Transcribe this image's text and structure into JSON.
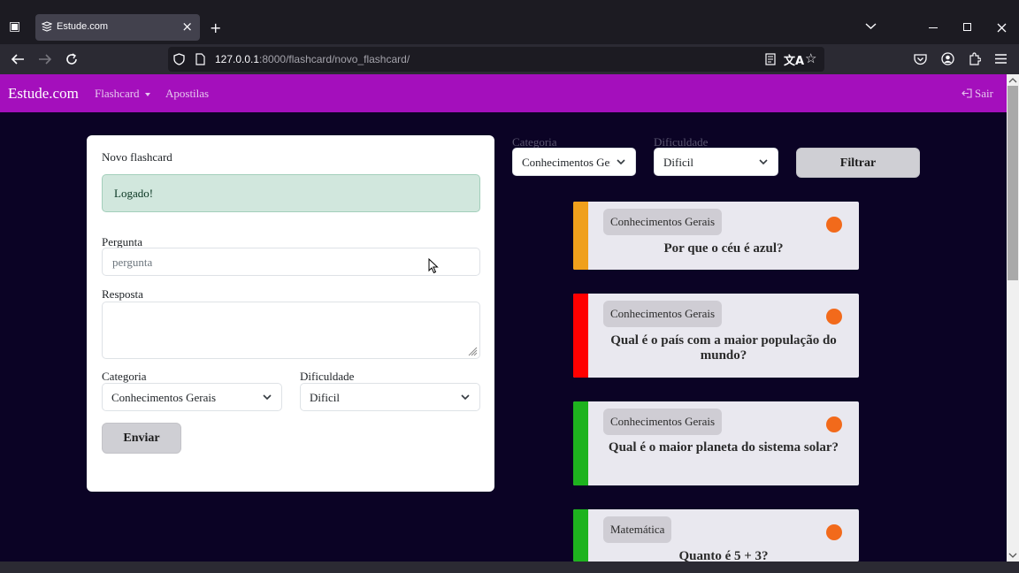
{
  "browser": {
    "tab_title": "Estude.com",
    "tab_close": "×",
    "new_tab": "+",
    "url_host": "127.0.0.1",
    "url_rest": ":8000/flashcard/novo_flashcard/"
  },
  "site_nav": {
    "brand": "Estude.com",
    "flashcard": "Flashcard",
    "apostilas": "Apostilas",
    "sair": "Sair"
  },
  "form": {
    "title": "Novo flashcard",
    "alert": "Logado!",
    "pergunta_label": "Pergunta",
    "pergunta_placeholder": "pergunta",
    "resposta_label": "Resposta",
    "categoria_label": "Categoria",
    "categoria_value": "Conhecimentos Gerais",
    "dificuldade_label": "Dificuldade",
    "dificuldade_value": "Dificil",
    "submit": "Enviar"
  },
  "filters": {
    "categoria_label": "Categoria",
    "categoria_value": "Conhecimentos Gerais",
    "dificuldade_label": "Dificuldade",
    "dificuldade_value": "Dificil",
    "submit": "Filtrar"
  },
  "flashcards": [
    {
      "category": "Conhecimentos Gerais",
      "question": "Por que o céu é azul?",
      "stripe_color": "#f0a01c",
      "dot_color": "#f26a1b"
    },
    {
      "category": "Conhecimentos Gerais",
      "question": "Qual é o país com a maior população do mundo?",
      "stripe_color": "#ff0000",
      "dot_color": "#f26a1b"
    },
    {
      "category": "Conhecimentos Gerais",
      "question": "Qual é o maior planeta do sistema solar?",
      "stripe_color": "#1eb31e",
      "dot_color": "#f26a1b"
    },
    {
      "category": "Matemática",
      "question": "Quanto é 5 + 3?",
      "stripe_color": "#1eb31e",
      "dot_color": "#f26a1b"
    }
  ]
}
